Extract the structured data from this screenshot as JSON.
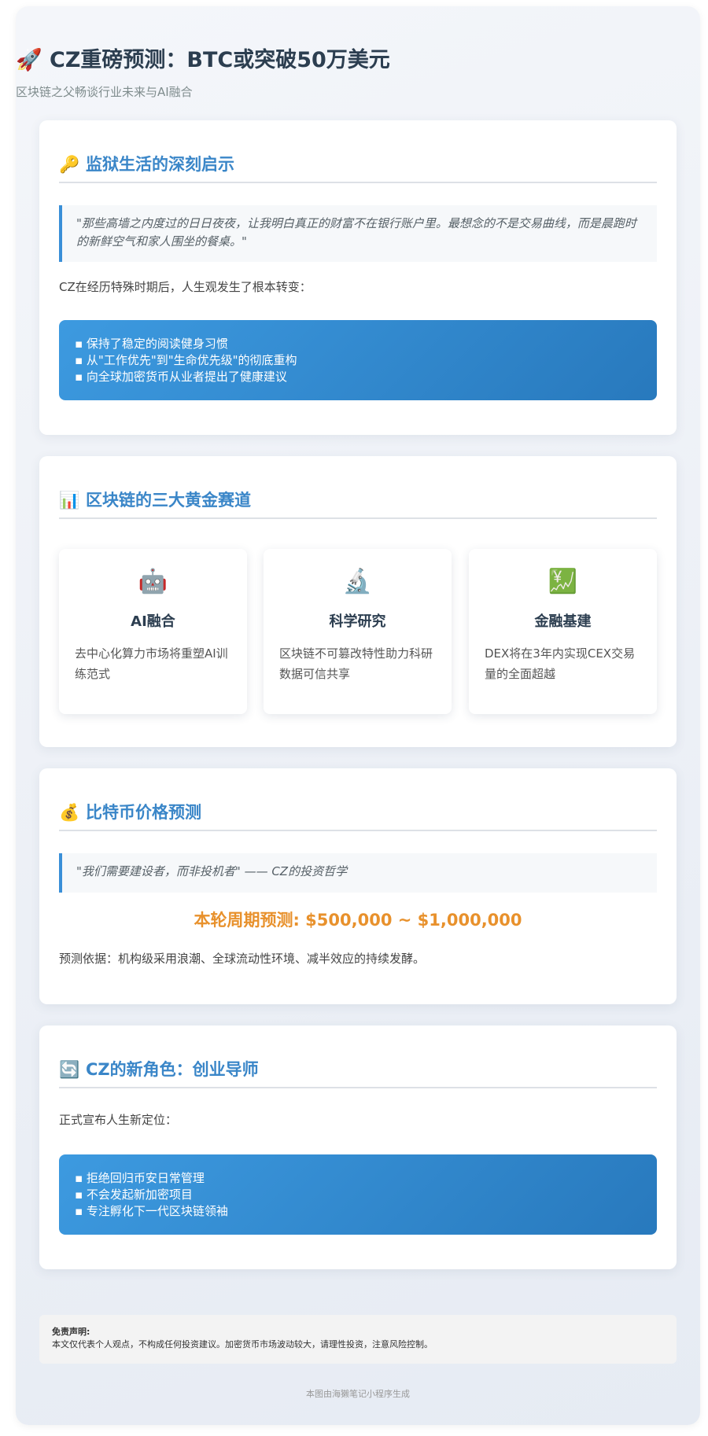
{
  "header": {
    "icon": "🚀",
    "title": "CZ重磅预测：BTC或突破50万美元",
    "subtitle": "区块链之父畅谈行业未来与AI融合"
  },
  "sections": {
    "prison": {
      "icon": "🔑",
      "title": "监狱生活的深刻启示",
      "quote": "\"那些高墙之内度过的日日夜夜，让我明白真正的财富不在银行账户里。最想念的不是交易曲线，而是晨跑时的新鲜空气和家人围坐的餐桌。\"",
      "intro": "CZ在经历特殊时期后，人生观发生了根本转变：",
      "points": [
        "▪ 保持了稳定的阅读健身习惯",
        "▪ 从\"工作优先\"到\"生命优先级\"的彻底重构",
        "▪ 向全球加密货币从业者提出了健康建议"
      ]
    },
    "tracks": {
      "icon": "📊",
      "title": "区块链的三大黄金赛道",
      "items": [
        {
          "icon": "🤖",
          "title": "AI融合",
          "desc": "去中心化算力市场将重塑AI训练范式"
        },
        {
          "icon": "🔬",
          "title": "科学研究",
          "desc": "区块链不可篡改特性助力科研数据可信共享"
        },
        {
          "icon": "💹",
          "title": "金融基建",
          "desc": "DEX将在3年内实现CEX交易量的全面超越"
        }
      ]
    },
    "price": {
      "icon": "💰",
      "title": "比特币价格预测",
      "quote": "\"我们需要建设者，而非投机者\" —— CZ的投资哲学",
      "prediction": "本轮周期预测: $500,000 ~ $1,000,000",
      "basis": "预测依据：机构级采用浪潮、全球流动性环境、减半效应的持续发酵。"
    },
    "role": {
      "icon": "🔄",
      "title": "CZ的新角色：创业导师",
      "intro": "正式宣布人生新定位：",
      "points": [
        "▪ 拒绝回归币安日常管理",
        "▪ 不会发起新加密项目",
        "▪ 专注孵化下一代区块链领袖"
      ]
    }
  },
  "disclaimer": {
    "title": "免责声明:",
    "text": "本文仅代表个人观点，不构成任何投资建议。加密货币市场波动较大，请理性投资，注意风险控制。"
  },
  "footer": "本图由海獭笔记小程序生成"
}
